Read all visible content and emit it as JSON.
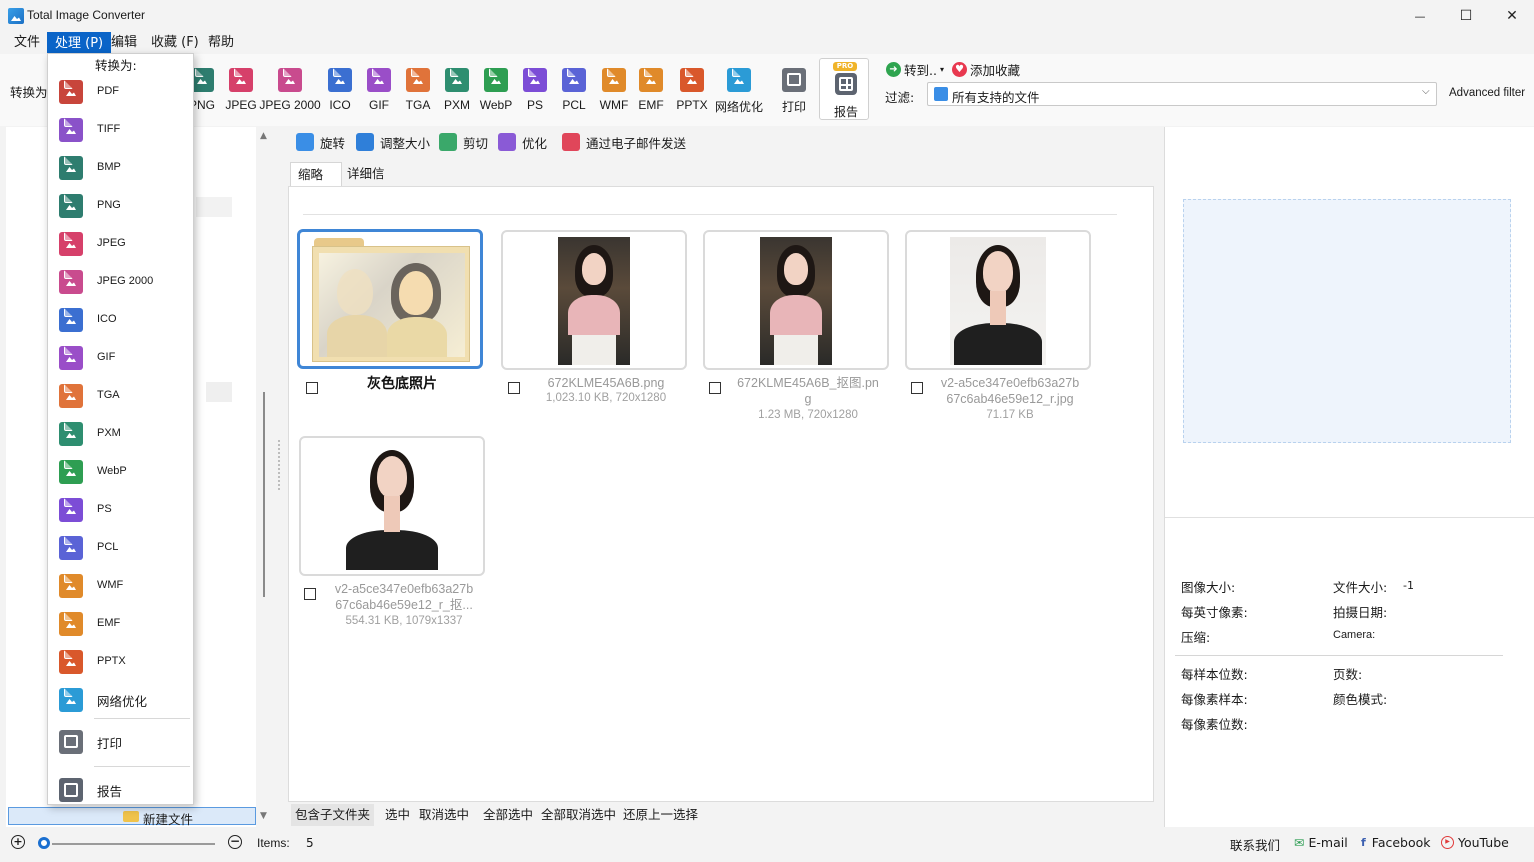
{
  "window": {
    "title": "Total Image Converter",
    "minimize": "—",
    "maximize": "☐",
    "close": "✕"
  },
  "menu": [
    "文件",
    "处理 (P)",
    "编辑",
    "收藏 (F)",
    "帮助"
  ],
  "toolbar": {
    "convert_to_label": "转换为",
    "formats": [
      {
        "label": "PNG",
        "color": "#2e7d6f"
      },
      {
        "label": "JPEG",
        "color": "#d6406a"
      },
      {
        "label": "JPEG 2000",
        "color": "#c94b8e"
      },
      {
        "label": "ICO",
        "color": "#3b6fd1"
      },
      {
        "label": "GIF",
        "color": "#9a4ec8"
      },
      {
        "label": "TGA",
        "color": "#e0733a"
      },
      {
        "label": "PXM",
        "color": "#2e8e70"
      },
      {
        "label": "WebP",
        "color": "#2e9e52"
      },
      {
        "label": "PS",
        "color": "#7c4dd6"
      },
      {
        "label": "PCL",
        "color": "#5a63d6"
      },
      {
        "label": "WMF",
        "color": "#e08a2a"
      },
      {
        "label": "EMF",
        "color": "#e08a2a"
      },
      {
        "label": "PPTX",
        "color": "#d9582b"
      },
      {
        "label": "网络优化",
        "color": "#2b9bd6"
      }
    ],
    "print_label": "打印",
    "report_label": "报告",
    "pro_badge": "PRO",
    "goto_label": "转到..",
    "favorite_label": "添加收藏",
    "filter_label": "过滤:",
    "filter_value": "所有支持的文件",
    "advanced_filter": "Advanced filter"
  },
  "subtoolbar": [
    "旋转",
    "调整大小",
    "剪切",
    "优化",
    "通过电子邮件发送"
  ],
  "tabs": [
    "缩略图",
    "详细信息"
  ],
  "files": [
    {
      "name": "灰色底照片",
      "meta": "",
      "kind": "folder"
    },
    {
      "name": "672KLME45A6B.png",
      "meta": "1,023.10 KB, 720x1280",
      "kind": "city"
    },
    {
      "name": "672KLME45A6B_抠图.pn",
      "name2": "g",
      "meta": "1.23 MB, 720x1280",
      "kind": "city"
    },
    {
      "name": "v2-a5ce347e0efb63a27b",
      "name2": "67c6ab46e59e12_r.jpg",
      "meta": "71.17 KB",
      "kind": "white"
    },
    {
      "name": "v2-a5ce347e0efb63a27b",
      "name2": "67c6ab46e59e12_r_抠...",
      "meta": "554.31 KB, 1079x1337",
      "kind": "white"
    }
  ],
  "selection_bar": [
    "包含子文件夹",
    "选中",
    "取消选中",
    "全部选中",
    "全部取消选中",
    "还原上一选择"
  ],
  "left_panel": {
    "new_folder": "新建文件"
  },
  "status": {
    "items_label": "Items:",
    "items_value": "5",
    "contact": "联系我们",
    "email": "E-mail",
    "facebook": "Facebook",
    "youtube": "YouTube"
  },
  "properties": {
    "image_size": "图像大小:",
    "file_size": "文件大小:",
    "file_size_value": "-1",
    "dpi": "每英寸像素:",
    "date_taken": "拍摄日期:",
    "compression": "压缩:",
    "camera": "Camera:",
    "bits_per_sample": "每样本位数:",
    "pages": "页数:",
    "samples_per_pixel": "每像素样本:",
    "color_mode": "颜色模式:",
    "bits_per_pixel": "每像素位数:"
  },
  "dropdown": {
    "header": "转换为:",
    "items": [
      {
        "label": "PDF",
        "color": "#c8453b"
      },
      {
        "label": "TIFF",
        "color": "#8a52c9"
      },
      {
        "label": "BMP",
        "color": "#2e7d6f"
      },
      {
        "label": "PNG",
        "color": "#2e7d6f"
      },
      {
        "label": "JPEG",
        "color": "#d6406a"
      },
      {
        "label": "JPEG 2000",
        "color": "#c94b8e"
      },
      {
        "label": "ICO",
        "color": "#3b6fd1"
      },
      {
        "label": "GIF",
        "color": "#9a4ec8"
      },
      {
        "label": "TGA",
        "color": "#e0733a"
      },
      {
        "label": "PXM",
        "color": "#2e8e70"
      },
      {
        "label": "WebP",
        "color": "#2e9e52"
      },
      {
        "label": "PS",
        "color": "#7c4dd6"
      },
      {
        "label": "PCL",
        "color": "#5a63d6"
      },
      {
        "label": "WMF",
        "color": "#e08a2a"
      },
      {
        "label": "EMF",
        "color": "#e08a2a"
      },
      {
        "label": "PPTX",
        "color": "#d9582b"
      },
      {
        "label": "网络优化",
        "color": "#2b9bd6"
      }
    ],
    "print_label": "打印",
    "report_label": "报告"
  }
}
